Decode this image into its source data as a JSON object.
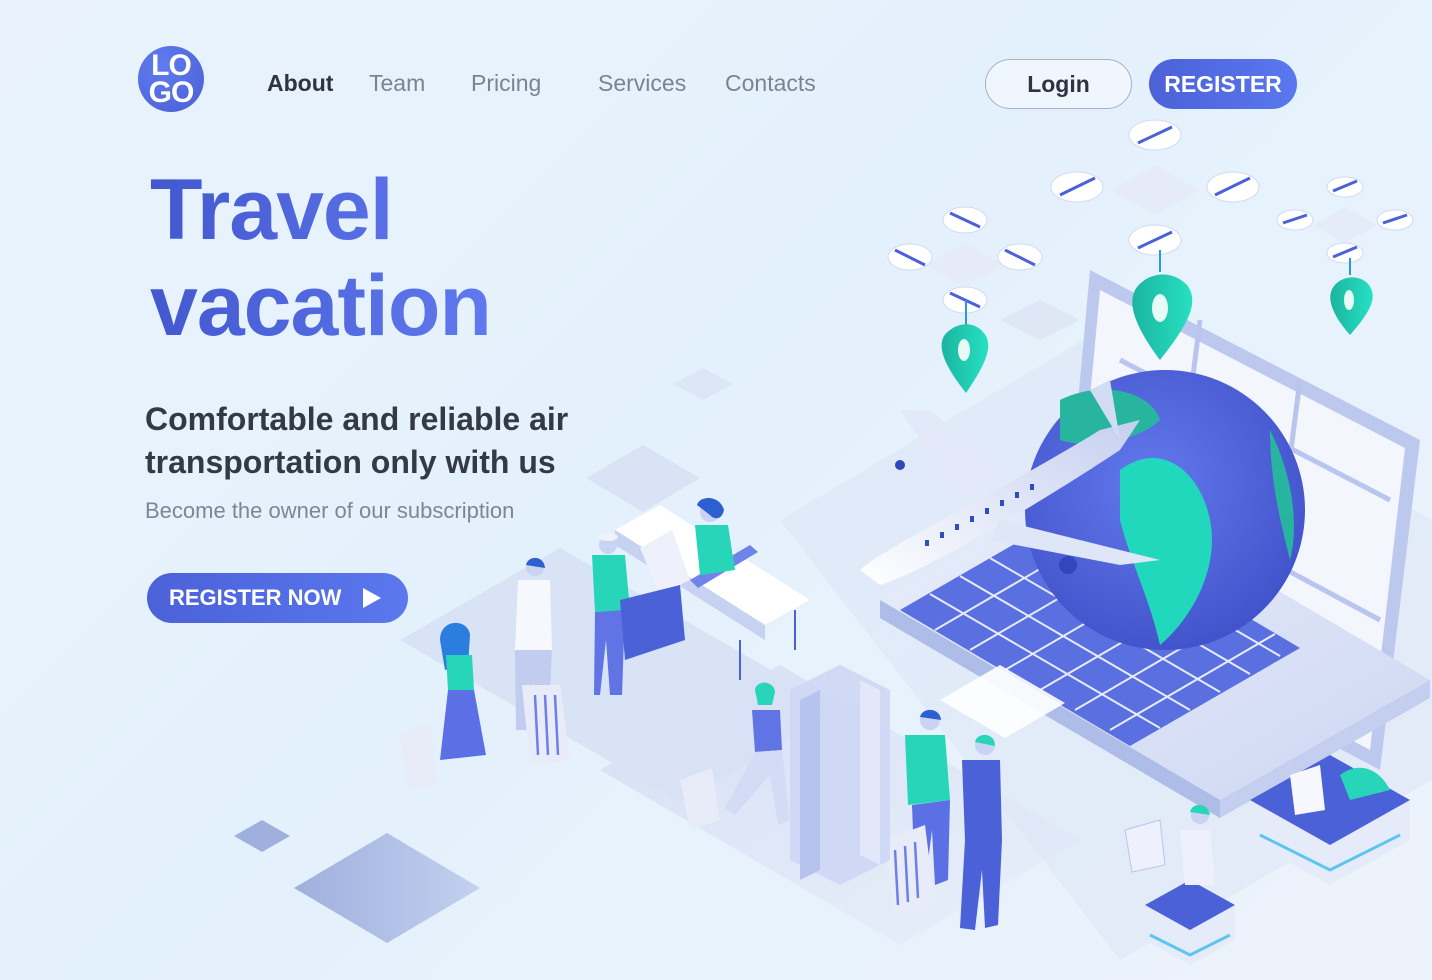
{
  "header": {
    "logo": {
      "line1": "LO",
      "line2": "GO"
    },
    "nav": [
      {
        "label": "About",
        "active": true
      },
      {
        "label": "Team",
        "active": false
      },
      {
        "label": "Pricing",
        "active": false
      },
      {
        "label": "Services",
        "active": false
      },
      {
        "label": "Contacts",
        "active": false
      }
    ],
    "login_label": "Login",
    "register_label": "REGISTER"
  },
  "hero": {
    "title_line1": "Travel",
    "title_line2": "vacation",
    "subtitle": "Comfortable and reliable air transportation only with us",
    "tagline": "Become the owner of our subscription",
    "cta_label": "REGISTER NOW",
    "cta_icon": "play-icon"
  },
  "illustration": {
    "description": "Isometric travel scene: laptop with globe, airplane, delivery drones with location pins, airport check-in desk, travelers with luggage, security gate, people with laptops",
    "icons": [
      "drone-icon",
      "location-pin-icon",
      "globe-icon",
      "airplane-icon",
      "laptop-icon",
      "suitcase-icon",
      "check-in-desk-icon",
      "security-gate-icon"
    ]
  },
  "colors": {
    "primary": "#4b61d8",
    "primary_light": "#5b78ee",
    "accent_teal": "#1fd3b4",
    "text_dark": "#2f3440",
    "text_muted": "#7d8793",
    "background": "#e6f2fc"
  }
}
